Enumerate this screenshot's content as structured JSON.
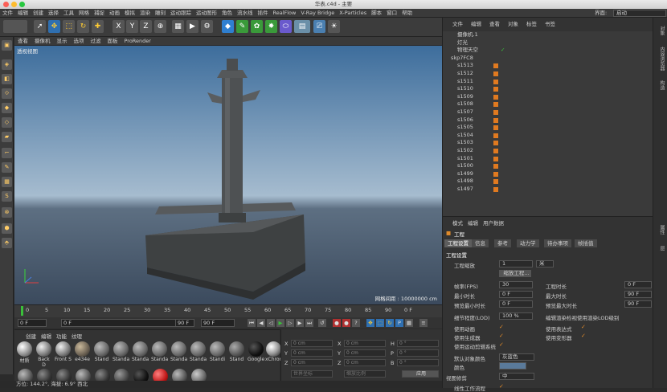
{
  "window": {
    "title": "华表.c4d - 主要"
  },
  "menu": [
    "文件",
    "编辑",
    "创建",
    "选择",
    "工具",
    "网格",
    "捕捉",
    "动画",
    "模拟",
    "渲染",
    "雕刻",
    "运动跟踪",
    "运动图形",
    "角色",
    "流水线",
    "插件",
    "RealFlow",
    "V-Ray Bridge",
    "X-Particles",
    "脚本",
    "窗口",
    "帮助"
  ],
  "layout": {
    "label": "界面:",
    "value": "启动"
  },
  "toolbar": {
    "x": "X",
    "y": "Y",
    "z": "Z"
  },
  "viewport": {
    "menu": [
      "查看",
      "摄像机",
      "显示",
      "选项",
      "过滤",
      "面板",
      "ProRender"
    ],
    "label": "透视视图",
    "grid": "网格间距 : 10000000 cm"
  },
  "timeline": {
    "ticks": [
      "0",
      "5",
      "10",
      "15",
      "20",
      "25",
      "30",
      "35",
      "40",
      "45",
      "50",
      "55",
      "60",
      "65",
      "70",
      "75",
      "80",
      "85",
      "90"
    ],
    "frame": "0 F"
  },
  "transport": {
    "start": "0 F",
    "mid": "0 F",
    "end": "90 F",
    "end2": "90 F"
  },
  "materials": {
    "menu": [
      "创建",
      "编辑",
      "功能",
      "纹理"
    ],
    "items": [
      "材质",
      "Back D",
      "Front S",
      "e434e",
      "Stand",
      "Standa",
      "Standa",
      "Standa",
      "Standa",
      "Standa",
      "Standi",
      "Stand",
      "Google",
      "xChrom"
    ]
  },
  "coords": {
    "rows": [
      {
        "a": "X",
        "av": "0 cm",
        "b": "X",
        "bv": "0 cm",
        "c": "H",
        "cv": "0 °"
      },
      {
        "a": "Y",
        "av": "0 cm",
        "b": "Y",
        "bv": "0 cm",
        "c": "P",
        "cv": "0 °"
      },
      {
        "a": "Z",
        "av": "0 cm",
        "b": "Z",
        "bv": "0 cm",
        "c": "B",
        "cv": "0 °"
      }
    ],
    "world": "世界坐标",
    "scale": "缩放比例",
    "apply": "应用"
  },
  "objects": {
    "menu": [
      "文件",
      "编辑",
      "查看",
      "对象",
      "标签",
      "书签"
    ],
    "items": [
      "摄像机.1",
      "灯光",
      "物理天空",
      "skp7FC8",
      "s1513",
      "s1512",
      "s1511",
      "s1510",
      "s1509",
      "s1508",
      "s1507",
      "s1506",
      "s1505",
      "s1504",
      "s1503",
      "s1502",
      "s1501",
      "s1500",
      "s1499",
      "s1498",
      "s1497"
    ]
  },
  "attributes": {
    "menu": [
      "模式",
      "编辑",
      "用户数据"
    ],
    "title": "工程",
    "tabs": [
      "工程设置",
      "信息",
      "参考",
      "动力学",
      "待办事项",
      "帧插值"
    ],
    "section": "工程设置",
    "scale_label": "工程缩放",
    "scale_value": "1",
    "scale_unit": "米",
    "scale_btn": "缩放工程...",
    "fps_label": "帧率(FPS)",
    "fps": "30",
    "dur_label": "工程时长",
    "dur": "0 F",
    "min_label": "最小时长",
    "min": "0 F",
    "max_label": "最大时长",
    "max": "90 F",
    "pmin_label": "预览最小时长",
    "pmin": "0 F",
    "pmax_label": "预览最大时长",
    "pmax": "90 F",
    "lod_label": "细节程度(LOD)",
    "lod": "100 %",
    "lod_edit": "编辑渲染检视使用渲染LOD级别",
    "anim": "使用动画",
    "expr": "使用表达式",
    "gen": "使用生成器",
    "deform": "使用变形器",
    "motion": "使用运动剪辑系统",
    "defcolor_label": "默认对象颜色",
    "defcolor": "灰蓝色",
    "color_label": "颜色",
    "view_label": "视图修剪",
    "view": "中",
    "linear_label": "线性工作流程",
    "input_label": "输入色彩特性",
    "input": "sRGB"
  },
  "side_tabs": [
    "对象",
    "内容浏览器",
    "构造",
    "属性",
    "层"
  ],
  "status": {
    "text": "方位: 144.2°, 海拔: 6.9° 西北"
  }
}
